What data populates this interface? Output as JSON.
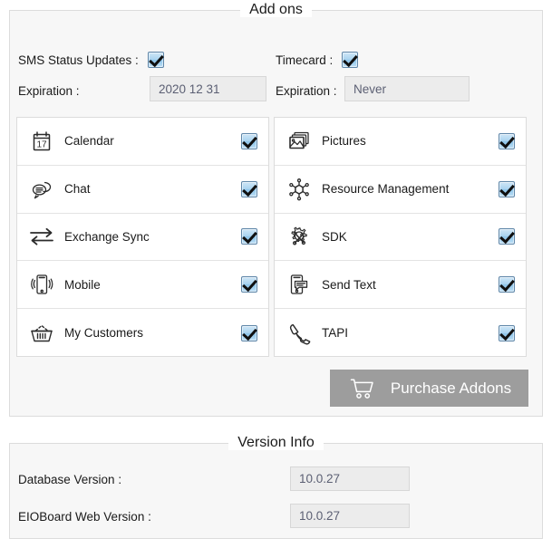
{
  "addons_section": {
    "title": "Add ons",
    "toggles": [
      {
        "label": "SMS Status Updates :",
        "checked": true,
        "expiration_label": "Expiration :",
        "expiration_value": "2020 12 31"
      },
      {
        "label": "Timecard :",
        "checked": true,
        "expiration_label": "Expiration :",
        "expiration_value": "Never"
      }
    ],
    "items_left": [
      {
        "label": "Calendar",
        "icon": "calendar-icon",
        "checked": true
      },
      {
        "label": "Chat",
        "icon": "chat-icon",
        "checked": true
      },
      {
        "label": "Exchange Sync",
        "icon": "exchange-sync-icon",
        "checked": true
      },
      {
        "label": "Mobile",
        "icon": "mobile-icon",
        "checked": true
      },
      {
        "label": "My Customers",
        "icon": "basket-icon",
        "checked": true
      }
    ],
    "items_right": [
      {
        "label": "Pictures",
        "icon": "pictures-icon",
        "checked": true
      },
      {
        "label": "Resource Management",
        "icon": "resource-management-icon",
        "checked": true
      },
      {
        "label": "SDK",
        "icon": "sdk-gear-tools-icon",
        "checked": true
      },
      {
        "label": "Send Text",
        "icon": "send-text-icon",
        "checked": true
      },
      {
        "label": "TAPI",
        "icon": "telephone-handset-icon",
        "checked": true
      }
    ],
    "purchase_button": {
      "label": "Purchase Addons",
      "icon": "shopping-cart-icon"
    }
  },
  "version_section": {
    "title": "Version Info",
    "rows": [
      {
        "label": "Database Version :",
        "value": "10.0.27"
      },
      {
        "label": "EIOBoard Web Version :",
        "value": "10.0.27"
      }
    ]
  },
  "colors": {
    "panel_bg": "#f7f7f7",
    "panel_border": "#dcdcdc",
    "checkbox_blue": "#a9d3ef",
    "checkbox_border": "#5f86a8",
    "button_gray": "#9d9d9d",
    "input_bg": "#ececec",
    "input_text": "#5b5f73"
  }
}
